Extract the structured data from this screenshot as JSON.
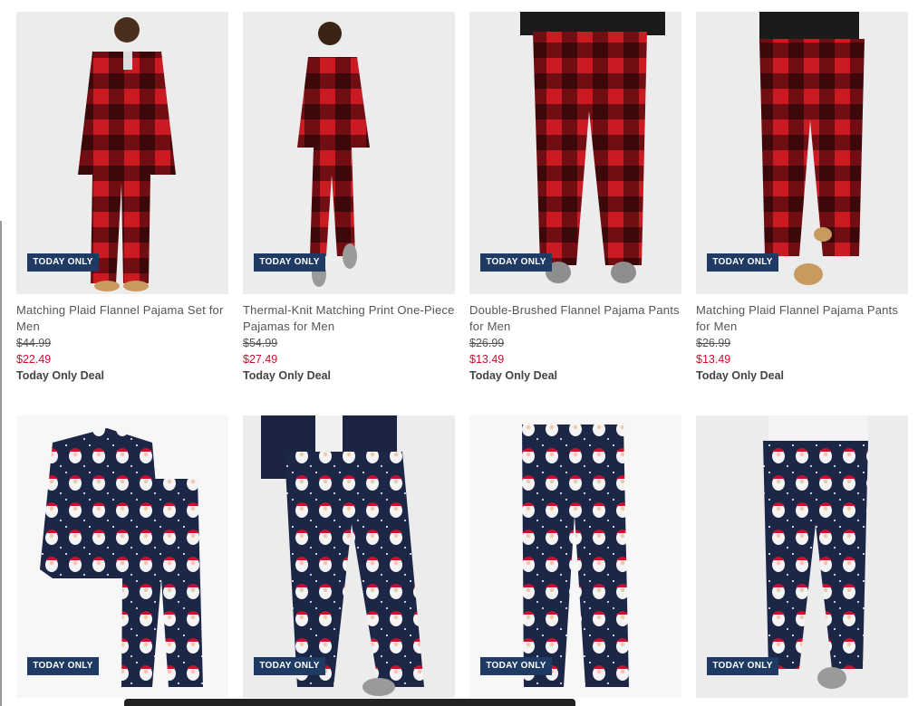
{
  "products": [
    {
      "name": "Matching Plaid Flannel Pajama Set for Men",
      "original_price": "$44.99",
      "sale_price": "$22.49",
      "deal": "Today Only Deal",
      "badge": "TODAY ONLY",
      "pattern": "red-black-buffalo-plaid",
      "garment": "pajama-set"
    },
    {
      "name": "Thermal-Knit Matching Print One-Piece Pajamas for Men",
      "original_price": "$54.99",
      "sale_price": "$27.49",
      "deal": "Today Only Deal",
      "badge": "TODAY ONLY",
      "pattern": "red-black-buffalo-plaid",
      "garment": "one-piece"
    },
    {
      "name": "Double-Brushed Flannel Pajama Pants for Men",
      "original_price": "$26.99",
      "sale_price": "$13.49",
      "deal": "Today Only Deal",
      "badge": "TODAY ONLY",
      "pattern": "red-black-buffalo-plaid",
      "garment": "pants"
    },
    {
      "name": "Matching Plaid Flannel Pajama Pants for Men",
      "original_price": "$26.99",
      "sale_price": "$13.49",
      "deal": "Today Only Deal",
      "badge": "TODAY ONLY",
      "pattern": "red-black-buffalo-plaid",
      "garment": "pants"
    },
    {
      "badge": "TODAY ONLY",
      "pattern": "navy-santa-print",
      "garment": "pajama-set-flatlay"
    },
    {
      "badge": "TODAY ONLY",
      "pattern": "navy-santa-print",
      "garment": "pants"
    },
    {
      "badge": "TODAY ONLY",
      "pattern": "navy-santa-print",
      "garment": "pants-flatlay"
    },
    {
      "badge": "TODAY ONLY",
      "pattern": "navy-santa-print",
      "garment": "pants"
    }
  ],
  "colors": {
    "badge_bg": "#1f3b64",
    "sale_price": "#c8102e",
    "plaid_red": "#cc1a22",
    "plaid_black": "#141414",
    "santa_navy": "#1c2748"
  }
}
